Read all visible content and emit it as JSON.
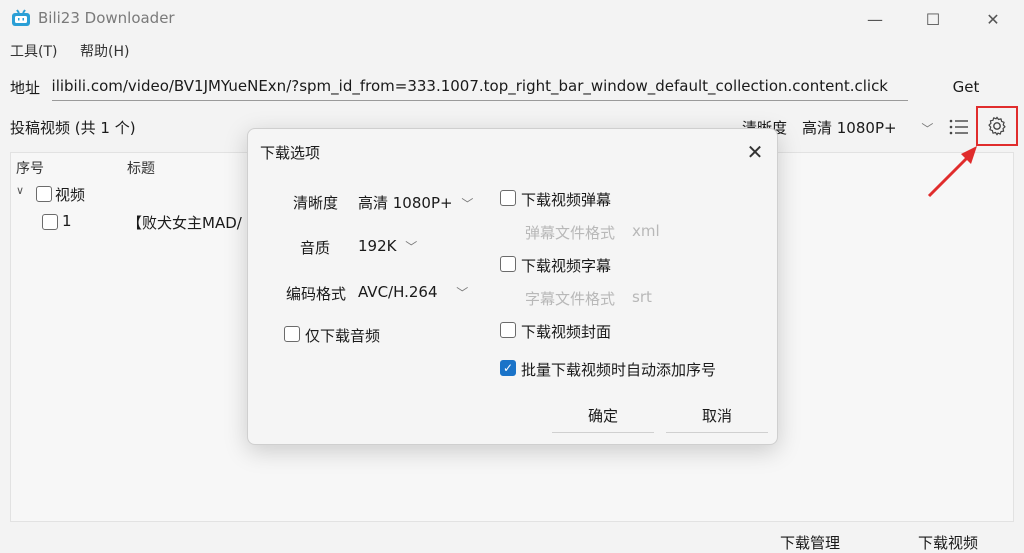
{
  "window": {
    "title": "Bili23 Downloader",
    "minimize": "—",
    "maximize": "☐",
    "close": "✕"
  },
  "menu": {
    "tools": "工具(T)",
    "help": "帮助(H)"
  },
  "address": {
    "label": "地址",
    "value": "bilibili.com/video/BV1JMYueNExn/?spm_id_from=333.1007.top_right_bar_window_default_collection.content.click",
    "get_label": "Get"
  },
  "toolbar": {
    "section_title": "投稿视频 (共 1 个)",
    "quality_label": "清晰度",
    "quality_value": "高清 1080P+",
    "list_icon": "list-icon",
    "settings_icon": "gear-icon"
  },
  "table": {
    "columns": [
      "序号",
      "标题"
    ],
    "group_label": "视频",
    "rows": [
      {
        "index": "1",
        "title": "【败犬女主MAD/"
      }
    ]
  },
  "bottom": {
    "manage": "下载管理",
    "download": "下载视频"
  },
  "dialog": {
    "title": "下载选项",
    "quality_label": "清晰度",
    "quality_value": "高清 1080P+",
    "audio_label": "音质",
    "audio_value": "192K",
    "codec_label": "编码格式",
    "codec_value": "AVC/H.264",
    "audio_only": "仅下载音频",
    "danmaku": "下载视频弹幕",
    "danmaku_format_label": "弹幕文件格式",
    "danmaku_format_value": "xml",
    "subtitle": "下载视频字幕",
    "subtitle_format_label": "字幕文件格式",
    "subtitle_format_value": "srt",
    "cover": "下载视频封面",
    "auto_number": "批量下载视频时自动添加序号",
    "ok": "确定",
    "cancel": "取消"
  },
  "colors": {
    "accent": "#1a73c8",
    "highlight": "#e02c2c"
  }
}
